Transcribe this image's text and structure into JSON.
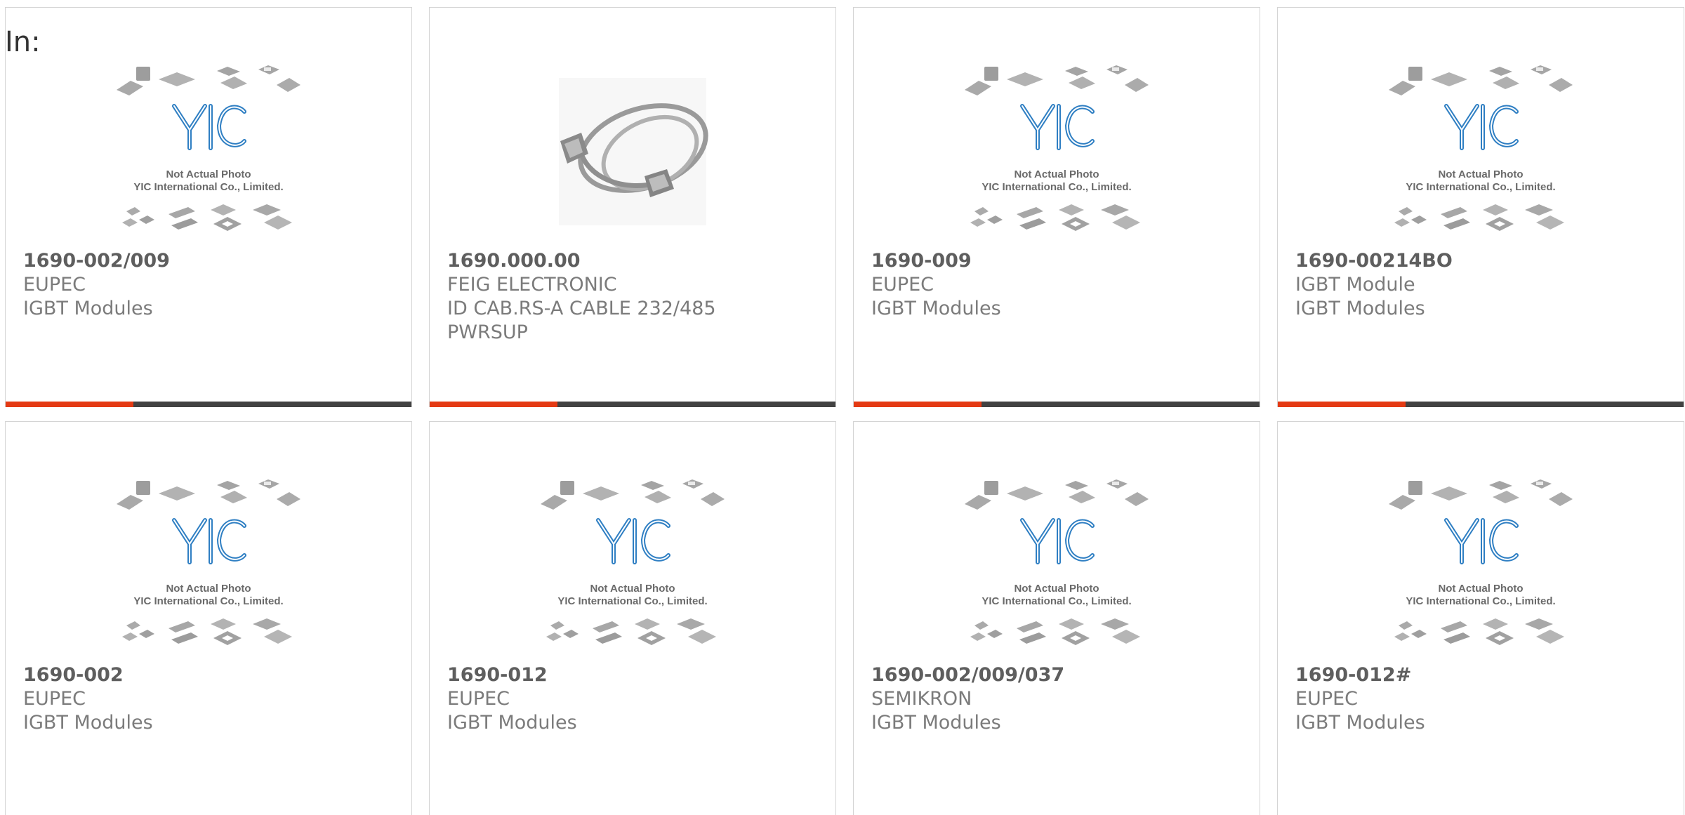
{
  "in_label": "In:",
  "placeholder": {
    "line1": "Not Actual Photo",
    "line2": "YIC International Co., Limited.",
    "logo": "YIC"
  },
  "colors": {
    "accent": "#e43a14",
    "bar": "#424242",
    "logo_blue": "#2f7fc3"
  },
  "products": [
    {
      "part": "1690-002/009",
      "brand": "EUPEC",
      "desc": "IGBT Modules",
      "image": "yic-placeholder"
    },
    {
      "part": "1690.000.00",
      "brand": "FEIG ELECTRONIC",
      "desc": "ID CAB.RS-A CABLE 232/485 PWRSUP",
      "image": "serial-cable-photo"
    },
    {
      "part": "1690-009",
      "brand": "EUPEC",
      "desc": "IGBT Modules",
      "image": "yic-placeholder"
    },
    {
      "part": "1690-00214BO",
      "brand": "IGBT Module",
      "desc": "IGBT Modules",
      "image": "yic-placeholder"
    },
    {
      "part": "1690-002",
      "brand": "EUPEC",
      "desc": "IGBT Modules",
      "image": "yic-placeholder"
    },
    {
      "part": "1690-012",
      "brand": "EUPEC",
      "desc": "IGBT Modules",
      "image": "yic-placeholder"
    },
    {
      "part": "1690-002/009/037",
      "brand": "SEMIKRON",
      "desc": "IGBT Modules",
      "image": "yic-placeholder"
    },
    {
      "part": "1690-012#",
      "brand": "EUPEC",
      "desc": "IGBT Modules",
      "image": "yic-placeholder"
    }
  ]
}
